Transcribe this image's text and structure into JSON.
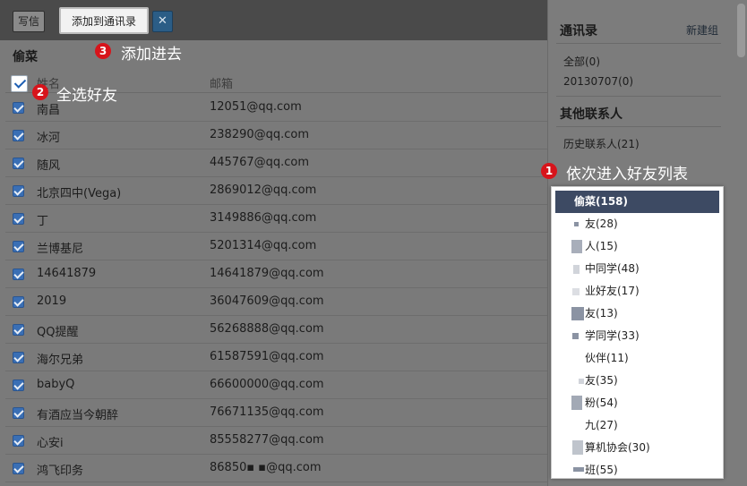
{
  "toolbar": {
    "write_label": "写信",
    "add_label": "添加到通讯录",
    "close_glyph": "✕"
  },
  "group_title": "偷菜",
  "table": {
    "col_name": "姓名",
    "col_mail": "邮箱",
    "rows": [
      {
        "name": "南昌",
        "mail": "12051@qq.com"
      },
      {
        "name": "冰河",
        "mail": "238290@qq.com"
      },
      {
        "name": "随风",
        "mail": "445767@qq.com"
      },
      {
        "name": "北京四中(Vega)",
        "mail": "2869012@qq.com"
      },
      {
        "name": "丁",
        "mail": "3149886@qq.com"
      },
      {
        "name": "兰博基尼",
        "mail": "5201314@qq.com"
      },
      {
        "name": "14641879",
        "mail": "14641879@qq.com"
      },
      {
        "name": "2019",
        "mail": "36047609@qq.com"
      },
      {
        "name": "QQ提醒",
        "mail": "56268888@qq.com"
      },
      {
        "name": "海尔兄弟",
        "mail": "61587591@qq.com"
      },
      {
        "name": "babyQ",
        "mail": "66600000@qq.com"
      },
      {
        "name": "有酒应当今朝醉",
        "mail": "76671135@qq.com"
      },
      {
        "name": "心安i",
        "mail": "85558277@qq.com"
      },
      {
        "name": "鸿飞印务",
        "mail": "86850▪ ▪@qq.com"
      }
    ]
  },
  "sidebar": {
    "title": "通讯录",
    "new_group": "新建组",
    "items": [
      "全部(0)",
      "20130707(0)"
    ],
    "other_title": "其他联系人",
    "history": "历史联系人(21)"
  },
  "dropdown": [
    {
      "label": "偷菜(158)",
      "active": true
    },
    {
      "label": "友(28)"
    },
    {
      "label": "人(15)"
    },
    {
      "label": "中同学(48)"
    },
    {
      "label": "业好友(17)"
    },
    {
      "label": "友(13)"
    },
    {
      "label": "学同学(33)"
    },
    {
      "label": "伙伴(11)"
    },
    {
      "label": "友(35)"
    },
    {
      "label": "粉(54)"
    },
    {
      "label": "九(27)"
    },
    {
      "label": "算机协会(30)"
    },
    {
      "label": "班(55)"
    }
  ],
  "annotations": [
    {
      "num": "1",
      "text": "依次进入好友列表"
    },
    {
      "num": "2",
      "text": "全选好友"
    },
    {
      "num": "3",
      "text": "添加进去"
    }
  ],
  "colors": {
    "badge": "#d7141b",
    "checkbox": "#3a6fb5",
    "dropdown_active": "#3d4a63"
  }
}
